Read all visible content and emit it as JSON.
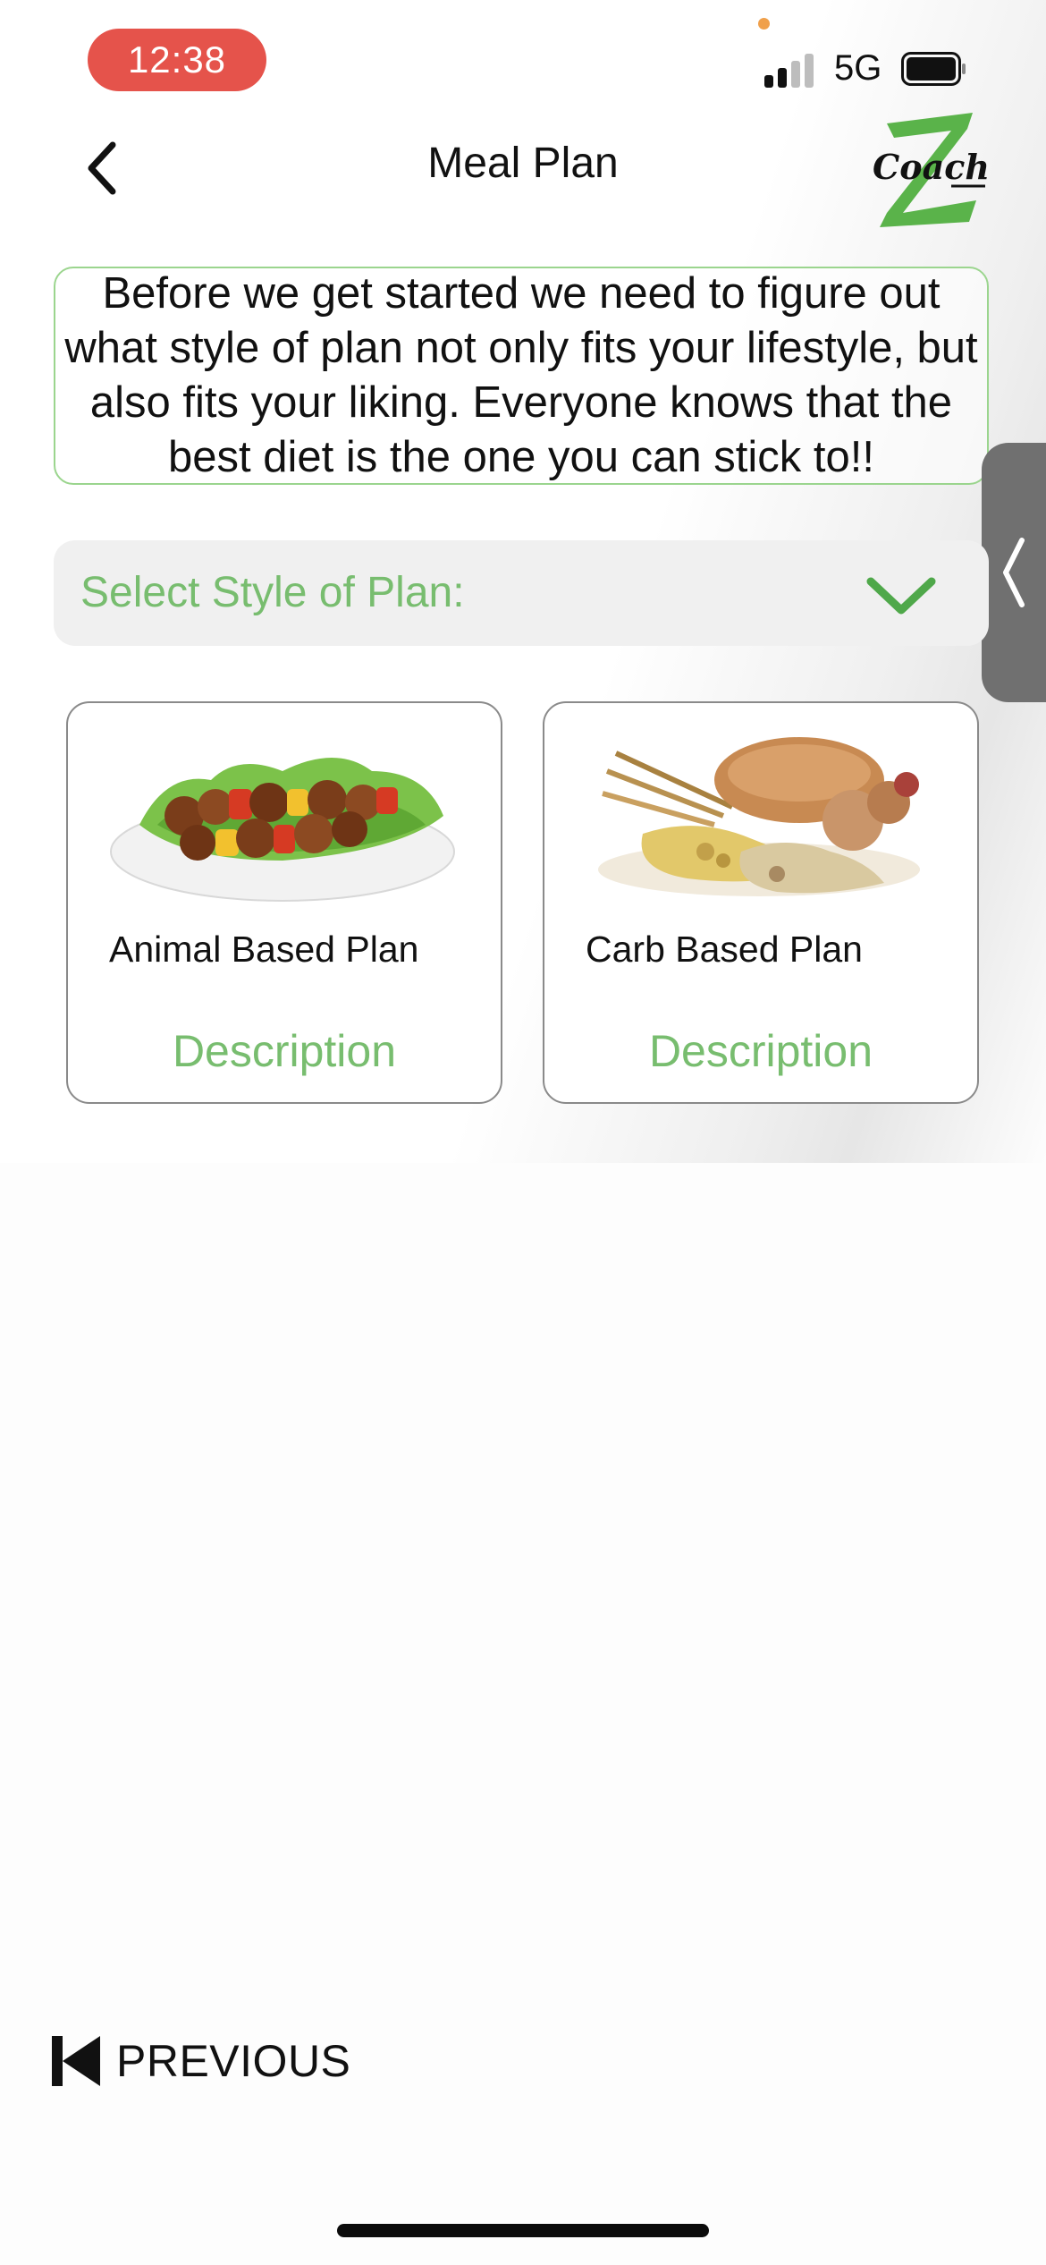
{
  "status_bar": {
    "time": "12:38",
    "network": "5G",
    "signal_bars_active": 2,
    "signal_bars_total": 4
  },
  "nav": {
    "title": "Meal Plan",
    "back_icon": "chevron-left-icon",
    "logo_text": "Coach"
  },
  "intro": {
    "text": "Before we get started we need to figure out what style of plan not only fits your lifestyle, but also fits your liking. Everyone knows that the best diet is the one you can stick to!!"
  },
  "plan_select": {
    "label": "Select Style of Plan:",
    "chevron_icon": "chevron-down-icon"
  },
  "plans": [
    {
      "name": "Animal Based Plan",
      "description_link": "Description",
      "image": "kebab-skewers-image"
    },
    {
      "name": "Carb Based Plan",
      "description_link": "Description",
      "image": "bread-grains-image"
    }
  ],
  "footer": {
    "previous_label": "PREVIOUS",
    "previous_icon": "skip-back-icon"
  },
  "colors": {
    "accent_green": "#78bd6f",
    "border_green": "#9bd58e",
    "time_pill": "#e5534b",
    "handle_gray": "#707070"
  }
}
